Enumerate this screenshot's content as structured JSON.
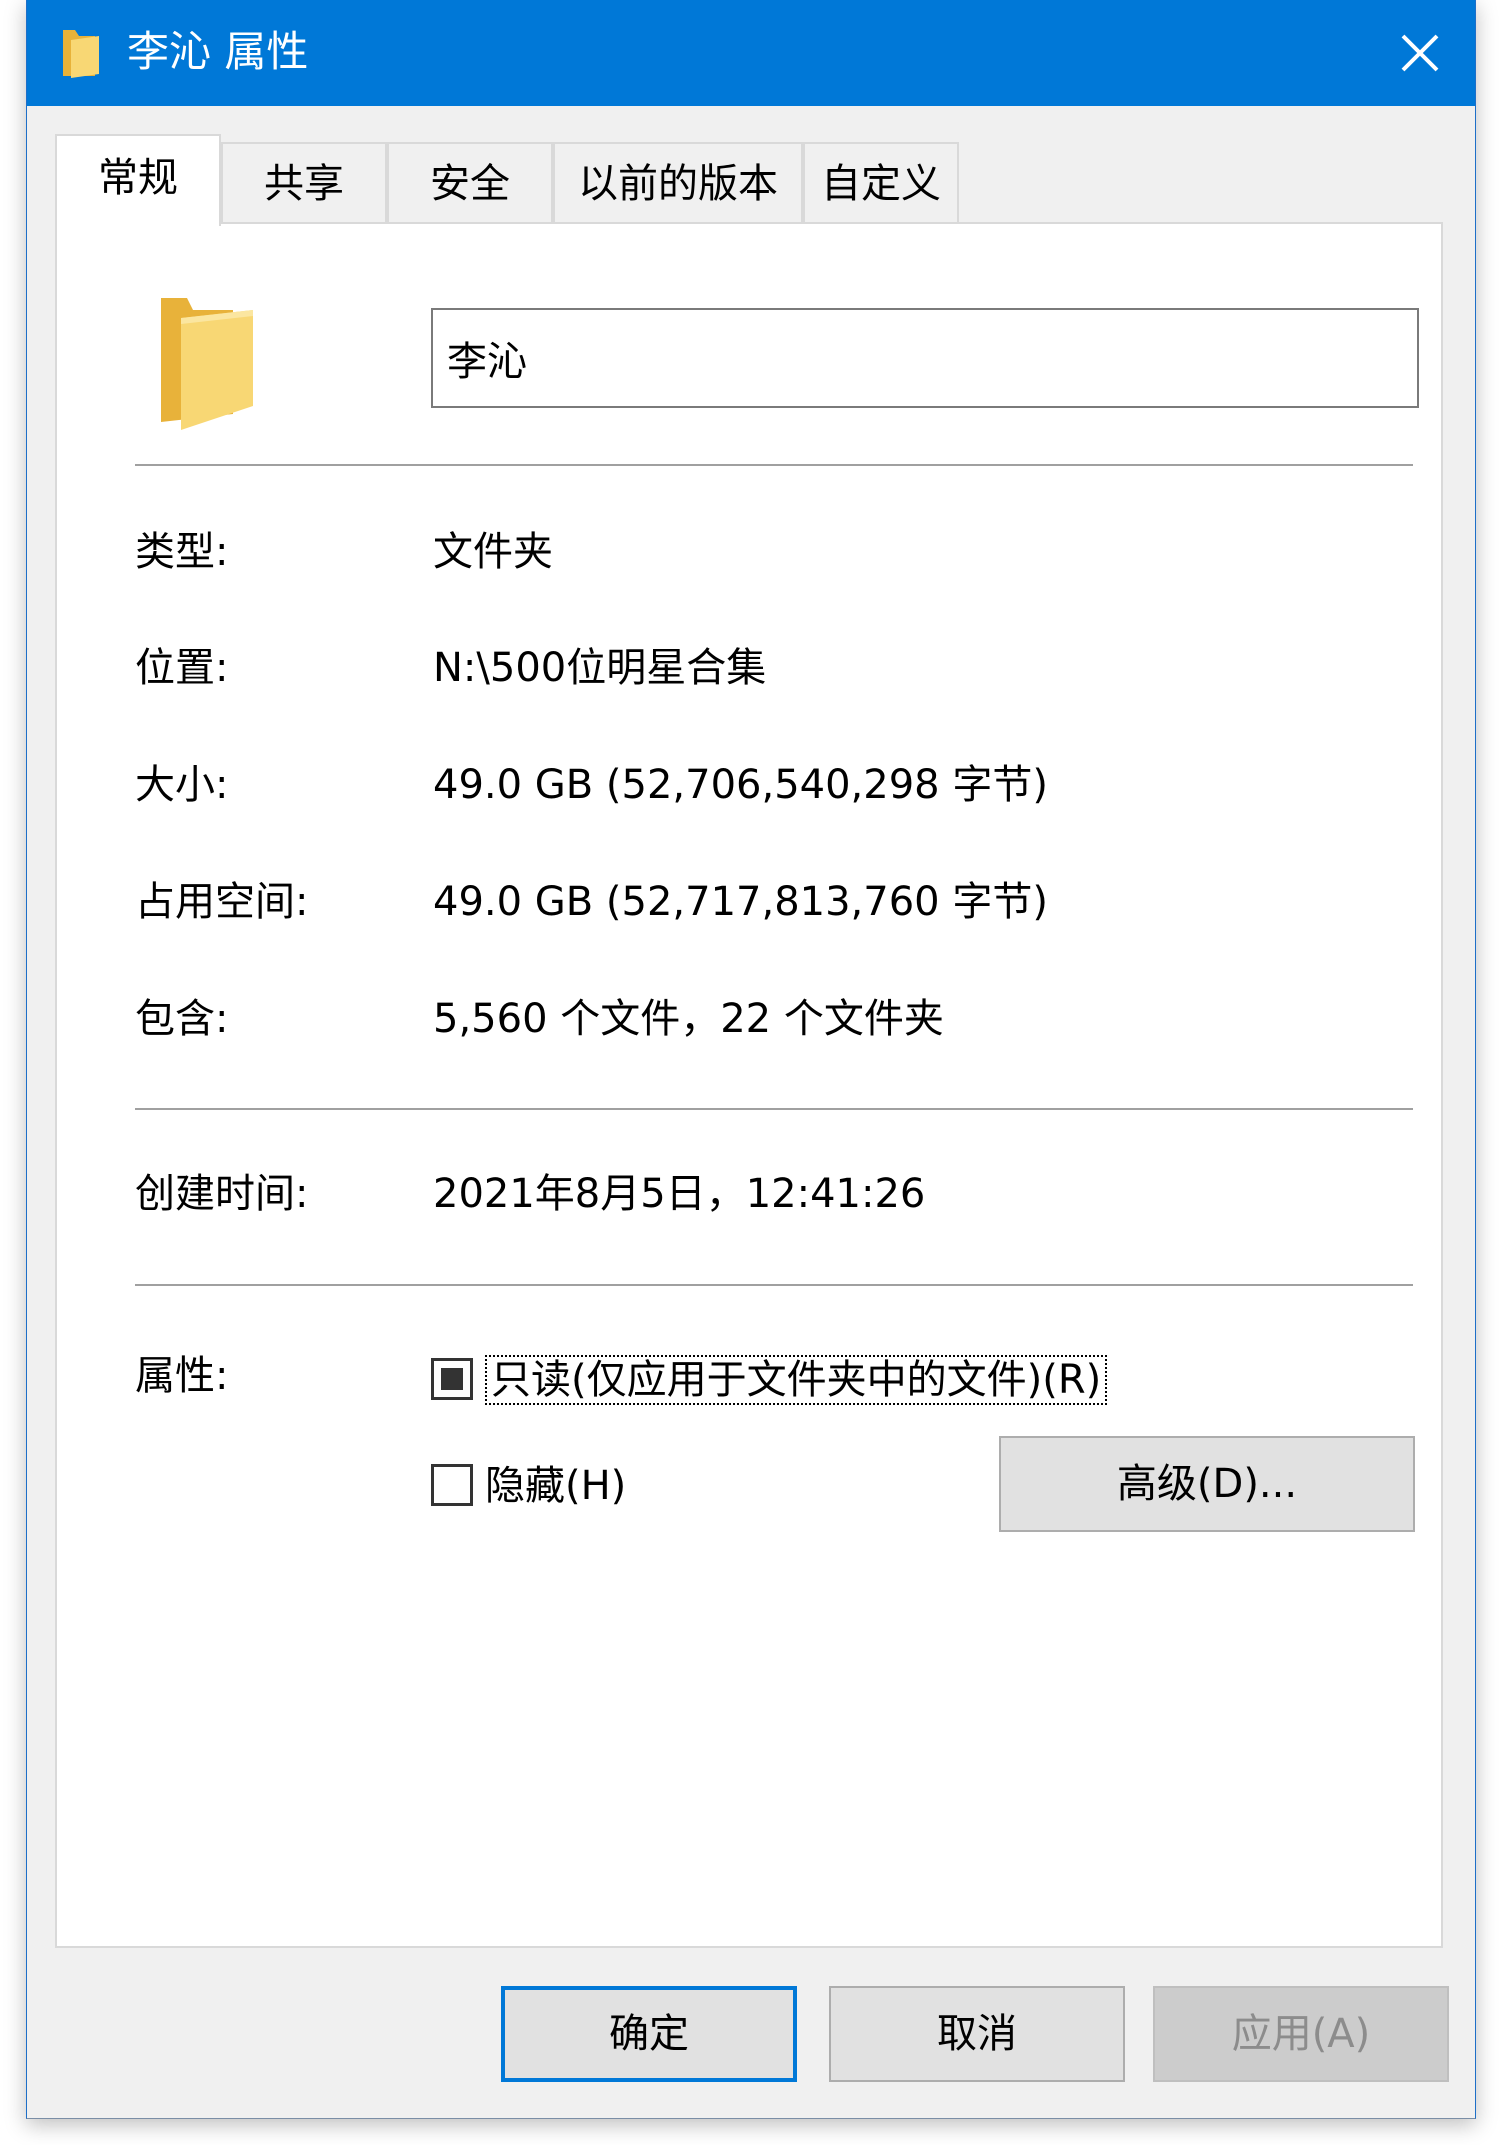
{
  "window": {
    "title": "李沁 属性",
    "close_label": "×"
  },
  "tabs": [
    {
      "label": "常规"
    },
    {
      "label": "共享"
    },
    {
      "label": "安全"
    },
    {
      "label": "以前的版本"
    },
    {
      "label": "自定义"
    }
  ],
  "general": {
    "name_value": "李沁",
    "rows": [
      {
        "label": "类型:",
        "value": "文件夹"
      },
      {
        "label": "位置:",
        "value": "N:\\500位明星合集"
      },
      {
        "label": "大小:",
        "value": "49.0 GB (52,706,540,298 字节)"
      },
      {
        "label": "占用空间:",
        "value": "49.0 GB (52,717,813,760 字节)"
      },
      {
        "label": "包含:",
        "value": "5,560 个文件，22 个文件夹"
      }
    ],
    "created": {
      "label": "创建时间:",
      "value": "2021年8月5日，12:41:26"
    },
    "attributes": {
      "label": "属性:",
      "readonly": {
        "label": "只读(仅应用于文件夹中的文件)(R)",
        "state": "indeterminate"
      },
      "hidden": {
        "label": "隐藏(H)",
        "state": "unchecked"
      },
      "advanced_button": "高级(D)..."
    }
  },
  "footer": {
    "ok": "确定",
    "cancel": "取消",
    "apply": "应用(A)"
  },
  "colors": {
    "titlebar": "#0078d7",
    "folder": "#f5c242"
  },
  "icons": {
    "title": "folder-icon",
    "close": "close-icon",
    "big": "folder-icon"
  }
}
